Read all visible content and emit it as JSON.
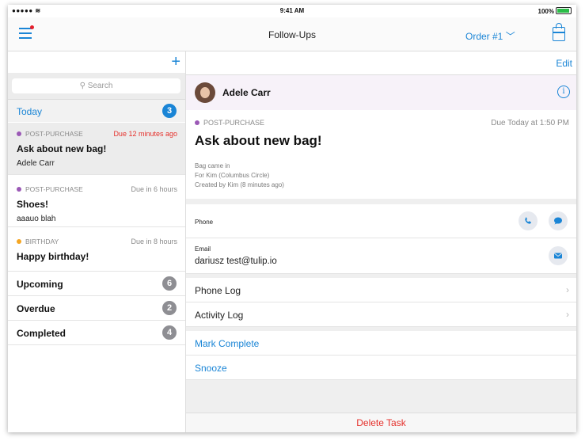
{
  "status": {
    "signal": "●●●●● ",
    "time": "9:41 AM",
    "battery": "100%"
  },
  "nav": {
    "title": "Follow-Ups",
    "order": "Order #1"
  },
  "left": {
    "search_placeholder": "Search",
    "today": {
      "label": "Today",
      "count": "3"
    },
    "tasks": [
      {
        "category": "POST-PURCHASE",
        "due": "Due 12 minutes ago",
        "title": "Ask about new bag!",
        "customer": "Adele Carr"
      },
      {
        "category": "POST-PURCHASE",
        "due": "Due in 6 hours",
        "title": "Shoes!",
        "customer": "aaauo blah"
      },
      {
        "category": "BIRTHDAY",
        "due": "Due in 8 hours",
        "title": "Happy birthday!"
      }
    ],
    "groups": [
      {
        "label": "Upcoming",
        "count": "6"
      },
      {
        "label": "Overdue",
        "count": "2"
      },
      {
        "label": "Completed",
        "count": "4"
      }
    ]
  },
  "right": {
    "edit_label": "Edit",
    "customer": "Adele Carr",
    "detail": {
      "category": "POST-PURCHASE",
      "due": "Due Today at 1:50 PM",
      "title": "Ask about new bag!",
      "notes": [
        "Bag came in",
        "For Kim (Columbus Circle)",
        "Created by Kim (8 minutes ago)"
      ]
    },
    "phone_label": "Phone",
    "email_label": "Email",
    "email_value": "dariusz test@tulip.io",
    "phone_log": "Phone Log",
    "activity_log": "Activity Log",
    "mark_complete": "Mark Complete",
    "snooze": "Snooze",
    "delete": "Delete Task"
  },
  "colors": {
    "accent": "#1a85d6",
    "danger": "#e5302b",
    "purple": "#9b59b6",
    "orange": "#f5a623",
    "gray_badge": "#8e8e93"
  }
}
